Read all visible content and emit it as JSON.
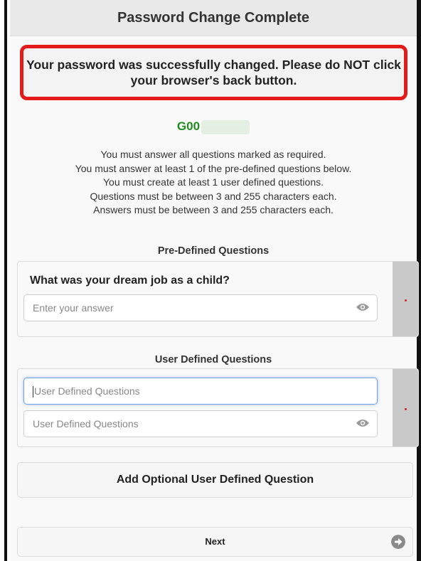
{
  "header": {
    "title": "Password Change Complete"
  },
  "alert": {
    "message": "Your password was successfully changed. Please do NOT click your browser's back button."
  },
  "user": {
    "id_prefix": "G00"
  },
  "instructions": [
    "You must answer all questions marked as required.",
    "You must answer at least 1 of the pre-defined questions below.",
    "You must create at least 1 user defined questions.",
    "Questions must be between 3 and 255 characters each.",
    "Answers must be between 3 and 255 characters each."
  ],
  "predefined": {
    "section_title": "Pre-Defined Questions",
    "question": "What was your dream job as a child?",
    "answer_placeholder": "Enter your answer"
  },
  "user_defined": {
    "section_title": "User Defined Questions",
    "question_placeholder": "User Defined Questions",
    "answer_placeholder": "User Defined Questions"
  },
  "buttons": {
    "add_optional": "Add Optional User Defined Question",
    "next": "Next"
  },
  "icons": {
    "eye": "eye-icon",
    "next_arrow": "arrow-right-circle-icon",
    "required": "required-dot-icon"
  },
  "colors": {
    "alert_border": "#e41b1b",
    "user_id": "#1f8b1f",
    "focus": "#6fa3e0"
  }
}
